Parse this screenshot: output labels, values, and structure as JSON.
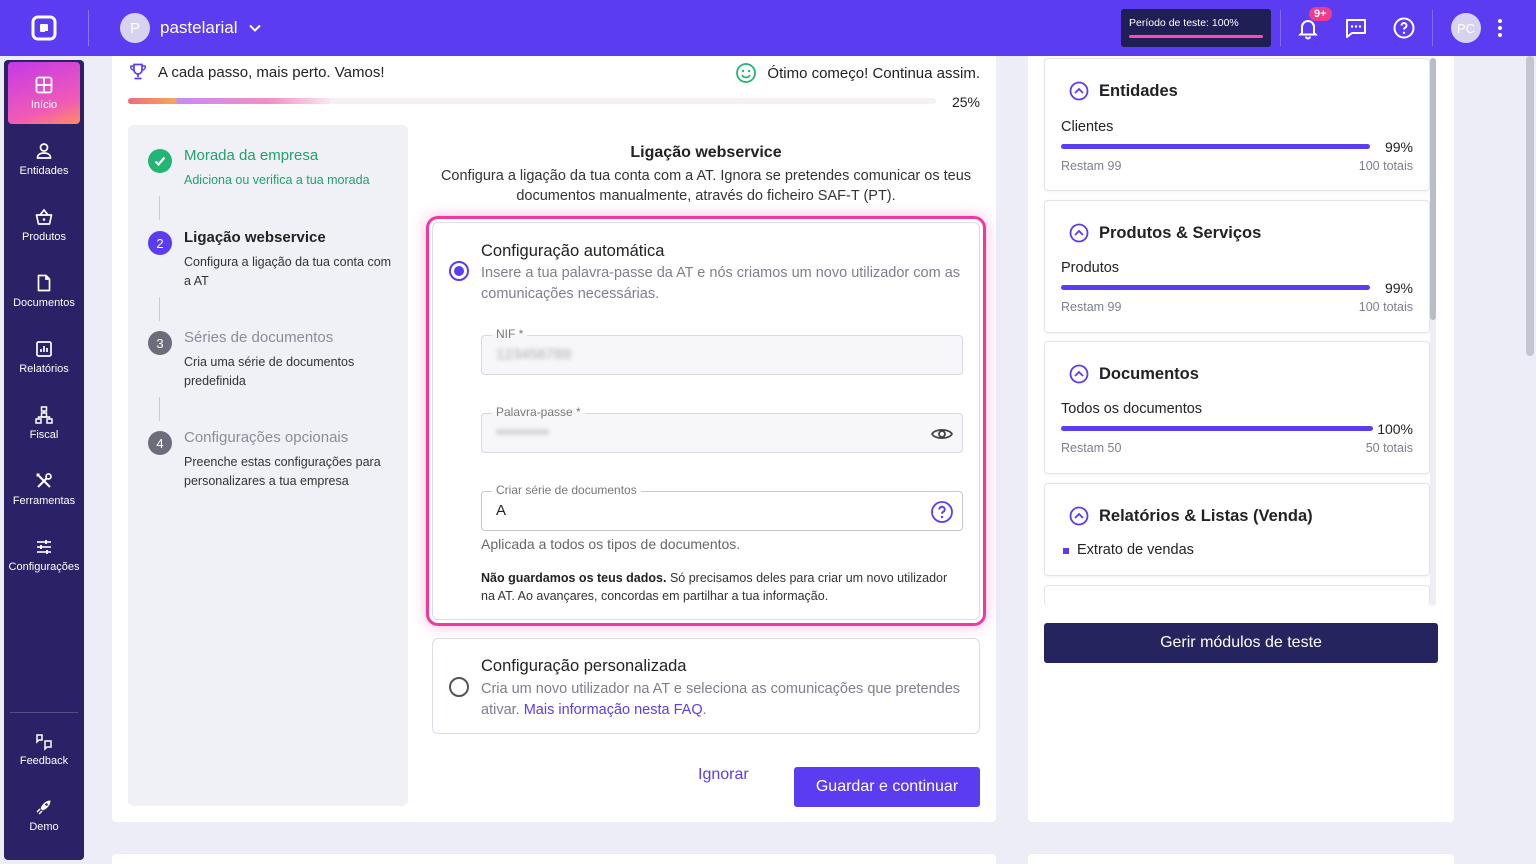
{
  "topbar": {
    "account_initial": "P",
    "account_name": "pastelarial",
    "trial_label": "Período de teste: 100%",
    "trial_progress": 1.0,
    "notifications_badge": "9+",
    "user_initials": "PC"
  },
  "sidebar": {
    "items": [
      {
        "label": "Início",
        "icon": "home-grid-icon"
      },
      {
        "label": "Entidades",
        "icon": "person-icon"
      },
      {
        "label": "Produtos",
        "icon": "basket-icon"
      },
      {
        "label": "Documentos",
        "icon": "document-icon"
      },
      {
        "label": "Relatórios",
        "icon": "chart-icon"
      },
      {
        "label": "Fiscal",
        "icon": "hierarchy-icon"
      },
      {
        "label": "Ferramentas",
        "icon": "tools-icon"
      },
      {
        "label": "Configurações",
        "icon": "sliders-icon"
      }
    ],
    "bottom": [
      {
        "label": "Feedback",
        "icon": "feedback-icon"
      },
      {
        "label": "Demo",
        "icon": "rocket-icon"
      }
    ]
  },
  "progress": {
    "left_message": "A cada passo, mais perto. Vamos!",
    "right_message": "Ótimo começo! Continua assim.",
    "percent_label": "25%",
    "value": 0.25
  },
  "steps": [
    {
      "number": "✓",
      "title": "Morada da empresa",
      "desc": "Adiciona ou verifica a tua morada",
      "state": "done"
    },
    {
      "number": "2",
      "title": "Ligação webservice",
      "desc": "Configura a ligação da tua conta com a AT",
      "state": "current"
    },
    {
      "number": "3",
      "title": "Séries de documentos",
      "desc": "Cria uma série de documentos predefinida",
      "state": "pending"
    },
    {
      "number": "4",
      "title": "Configurações opcionais",
      "desc": "Preenche estas configurações para personalizares a tua empresa",
      "state": "pending"
    }
  ],
  "form": {
    "title": "Ligação webservice",
    "subtitle": "Configura a ligação da tua conta com a AT. Ignora se pretendes comunicar os teus documentos manualmente, através do ficheiro SAF-T (PT).",
    "auto": {
      "title": "Configuração automática",
      "desc": "Insere a tua palavra-passe da AT e nós criamos um novo utilizador com as comunicações necessárias.",
      "nif_label": "NIF *",
      "nif_value": "123456789",
      "password_label": "Palavra-passe *",
      "password_value": "••••••••••",
      "series_label": "Criar série de documentos",
      "series_value": "A",
      "series_helper": "Aplicada a todos os tipos de documentos.",
      "note_bold": "Não guardamos os teus dados.",
      "note_rest": " Só precisamos deles para criar um novo utilizador na AT. Ao avançares, concordas em partilhar a tua informação."
    },
    "custom": {
      "title": "Configuração personalizada",
      "desc": "Cria um novo utilizador na AT e seleciona as comunicações que pretendes ativar. ",
      "link": "Mais informação nesta FAQ",
      "desc_end": "."
    },
    "ignore_label": "Ignorar",
    "save_label": "Guardar e continuar"
  },
  "modules": [
    {
      "title": "Entidades",
      "item": "Clientes",
      "percent": "99%",
      "value": 0.99,
      "left": "Restam 99",
      "total": "100 totais"
    },
    {
      "title": "Produtos & Serviços",
      "item": "Produtos",
      "percent": "99%",
      "value": 0.99,
      "left": "Restam 99",
      "total": "100 totais"
    },
    {
      "title": "Documentos",
      "item": "Todos os documentos",
      "percent": "100%",
      "value": 1.0,
      "left": "Restam 50",
      "total": "50 totais"
    },
    {
      "title": "Relatórios & Listas (Venda)",
      "bullet_item": "Extrato de vendas"
    }
  ],
  "manage_label": "Gerir módulos de teste"
}
